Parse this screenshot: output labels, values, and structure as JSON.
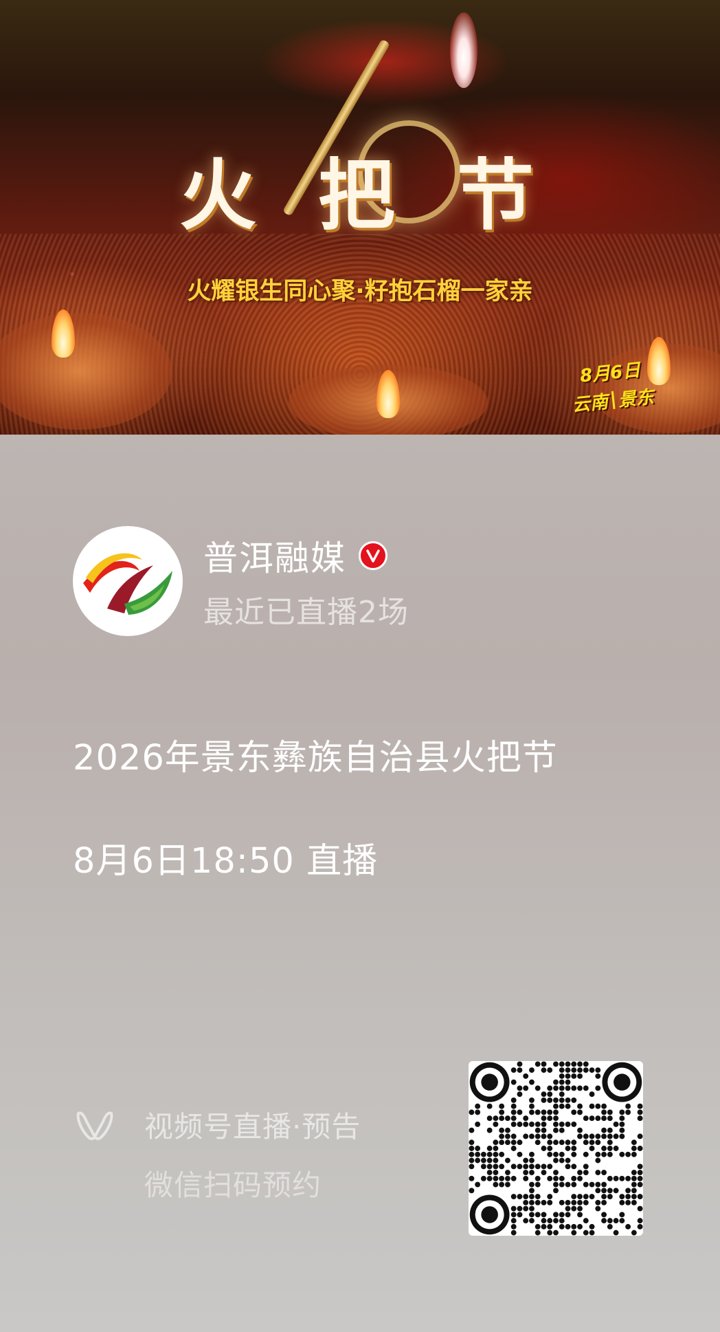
{
  "banner": {
    "title_chars": [
      "火",
      "把",
      "节"
    ],
    "subtitle": "火耀银生同心聚·籽抱石榴一家亲",
    "date": "8月6日",
    "location_left": "云南",
    "location_right": "景东"
  },
  "account": {
    "name": "普洱融媒",
    "verified_badge": "V",
    "live_count": "最近已直播2场"
  },
  "event": {
    "title": "2026年景东彝族自治县火把节",
    "time": "8月6日18:50 直播"
  },
  "footer": {
    "line1": "视频号直播·预告",
    "line2": "微信扫码预约"
  },
  "icons": {
    "channels": "wechat-channels-icon",
    "verified": "verified-icon",
    "qr": "qr-code"
  },
  "colors": {
    "verified_red": "#e4121d",
    "subtitle_gold": "#ffd23a"
  }
}
